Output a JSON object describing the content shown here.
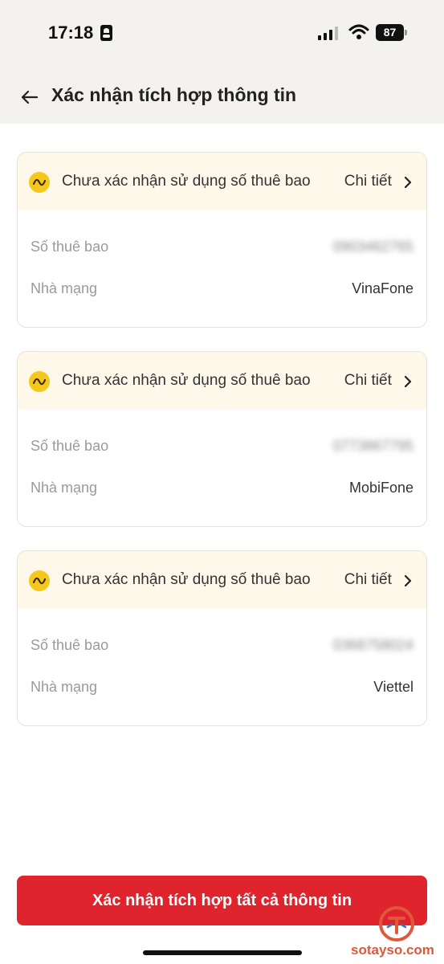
{
  "status_bar": {
    "time": "17:18",
    "battery": "87"
  },
  "header": {
    "title": "Xác nhận tích hợp thông tin"
  },
  "cards": [
    {
      "status": "Chưa xác nhận sử dụng số thuê bao",
      "detail_label": "Chi tiết",
      "subscriber_label": "Số thuê bao",
      "subscriber_value": "0903462765",
      "carrier_label": "Nhà mạng",
      "carrier_value": "VinaFone"
    },
    {
      "status": "Chưa xác nhận sử dụng số thuê bao",
      "detail_label": "Chi tiết",
      "subscriber_label": "Số thuê bao",
      "subscriber_value": "0773867795",
      "carrier_label": "Nhà mạng",
      "carrier_value": "MobiFone"
    },
    {
      "status": "Chưa xác nhận sử dụng số thuê bao",
      "detail_label": "Chi tiết",
      "subscriber_label": "Số thuê bao",
      "subscriber_value": "0368758024",
      "carrier_label": "Nhà mạng",
      "carrier_value": "Viettel"
    }
  ],
  "footer": {
    "confirm_label": "Xác nhận tích hợp tất cả thông tin"
  },
  "watermark": {
    "text": "sotayso.com"
  },
  "icons": {
    "back": "arrow-left-icon",
    "status": "warning-wave-icon",
    "chevron": "chevron-right-icon"
  },
  "colors": {
    "header_bg": "#f4f2ef",
    "card_head_bg": "#fdf8ea",
    "warning": "#f6c81e",
    "primary_button": "#e0242d"
  }
}
